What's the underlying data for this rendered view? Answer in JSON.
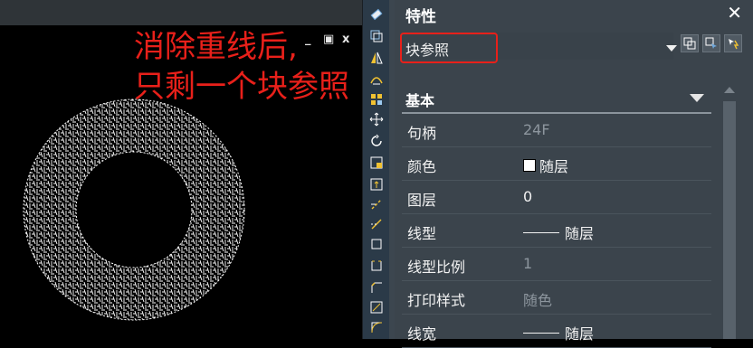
{
  "canvas": {
    "annotation_line1": "消除重线后,",
    "annotation_line2": "只剩一个块参照",
    "win_min": "_",
    "win_max": "▣",
    "win_close": "x"
  },
  "toolbar": {
    "tools": [
      "eraser-icon",
      "copy-icon",
      "mirror-icon",
      "offset-icon",
      "array-icon",
      "move-icon",
      "rotate-icon",
      "scale-icon",
      "stretch-icon",
      "trim-icon",
      "extend-icon",
      "break-icon",
      "join-icon",
      "chamfer-icon",
      "fillet-icon",
      "explode-icon"
    ]
  },
  "panel": {
    "title": "特性",
    "close": "✕",
    "selector_value": "块参照",
    "section_title": "基本",
    "properties": [
      {
        "label": "句柄",
        "value": "24F",
        "dim": true
      },
      {
        "label": "颜色",
        "value": "随层",
        "swatch": true
      },
      {
        "label": "图层",
        "value": "0"
      },
      {
        "label": "线型",
        "value": "随层",
        "line": true
      },
      {
        "label": "线型比例",
        "value": "1",
        "dim": true
      },
      {
        "label": "打印样式",
        "value": "随色",
        "dim": true
      },
      {
        "label": "线宽",
        "value": "随层",
        "line": true
      }
    ]
  },
  "colors": {
    "annotation": "#e8201a",
    "panel_bg": "#3b444c",
    "toolbar_bg": "#2b3a48"
  }
}
